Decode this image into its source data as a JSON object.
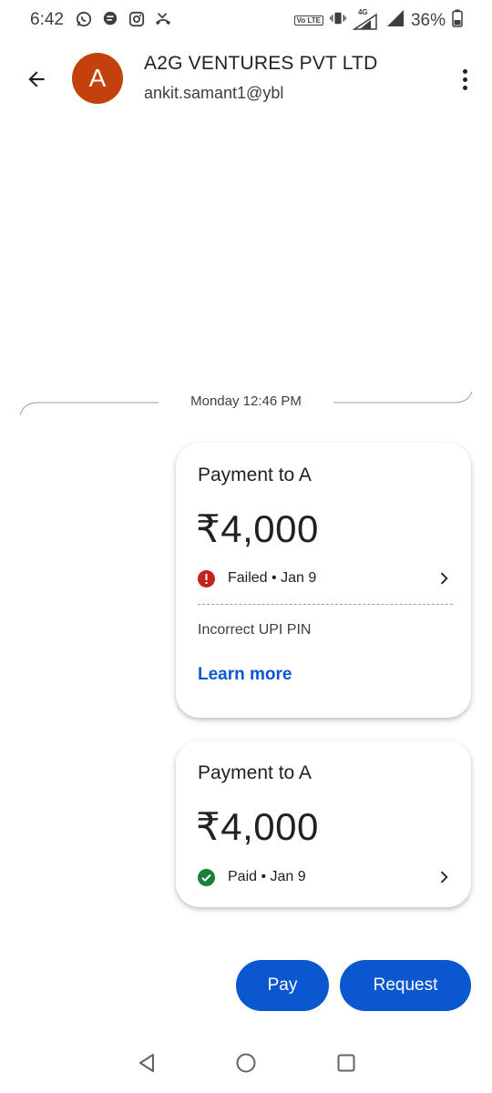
{
  "status_bar": {
    "time": "6:42",
    "notification_icons": [
      "whatsapp-icon",
      "message-icon",
      "instagram-icon",
      "missed-call-icon"
    ],
    "volte_label": "Vo LTE",
    "network": "4G",
    "battery": "36%"
  },
  "header": {
    "avatar_letter": "A",
    "avatar_color": "#c2410c",
    "contact_name": "A2G VENTURES PVT LTD",
    "contact_upi": "ankit.samant1@ybl"
  },
  "timeline": {
    "date_label": "Monday 12:46 PM"
  },
  "payments": [
    {
      "title": "Payment to A",
      "amount": "₹4,000",
      "status": "Failed • Jan 9",
      "status_color": "#c5221f",
      "reason": "Incorrect UPI PIN",
      "link": "Learn more"
    },
    {
      "title": "Payment to A",
      "amount": "₹4,000",
      "status": "Paid • Jan 9",
      "status_color": "#188038"
    }
  ],
  "actions": {
    "pay_label": "Pay",
    "request_label": "Request",
    "accent_color": "#0b57d0"
  }
}
